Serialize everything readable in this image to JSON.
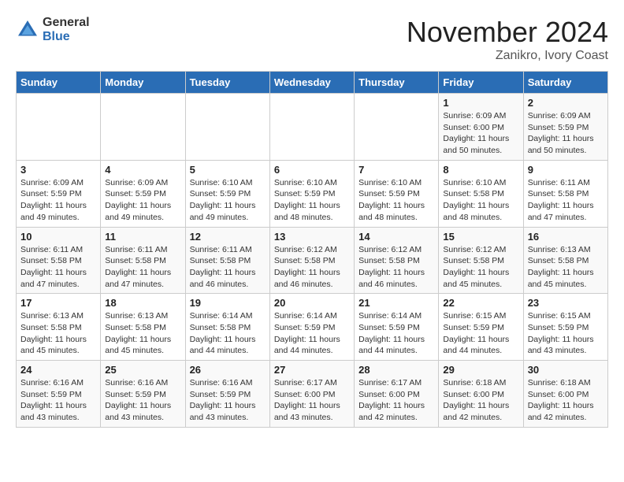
{
  "header": {
    "logo_general": "General",
    "logo_blue": "Blue",
    "month": "November 2024",
    "location": "Zanikro, Ivory Coast"
  },
  "weekdays": [
    "Sunday",
    "Monday",
    "Tuesday",
    "Wednesday",
    "Thursday",
    "Friday",
    "Saturday"
  ],
  "weeks": [
    [
      {
        "day": "",
        "info": ""
      },
      {
        "day": "",
        "info": ""
      },
      {
        "day": "",
        "info": ""
      },
      {
        "day": "",
        "info": ""
      },
      {
        "day": "",
        "info": ""
      },
      {
        "day": "1",
        "info": "Sunrise: 6:09 AM\nSunset: 6:00 PM\nDaylight: 11 hours\nand 50 minutes."
      },
      {
        "day": "2",
        "info": "Sunrise: 6:09 AM\nSunset: 5:59 PM\nDaylight: 11 hours\nand 50 minutes."
      }
    ],
    [
      {
        "day": "3",
        "info": "Sunrise: 6:09 AM\nSunset: 5:59 PM\nDaylight: 11 hours\nand 49 minutes."
      },
      {
        "day": "4",
        "info": "Sunrise: 6:09 AM\nSunset: 5:59 PM\nDaylight: 11 hours\nand 49 minutes."
      },
      {
        "day": "5",
        "info": "Sunrise: 6:10 AM\nSunset: 5:59 PM\nDaylight: 11 hours\nand 49 minutes."
      },
      {
        "day": "6",
        "info": "Sunrise: 6:10 AM\nSunset: 5:59 PM\nDaylight: 11 hours\nand 48 minutes."
      },
      {
        "day": "7",
        "info": "Sunrise: 6:10 AM\nSunset: 5:59 PM\nDaylight: 11 hours\nand 48 minutes."
      },
      {
        "day": "8",
        "info": "Sunrise: 6:10 AM\nSunset: 5:58 PM\nDaylight: 11 hours\nand 48 minutes."
      },
      {
        "day": "9",
        "info": "Sunrise: 6:11 AM\nSunset: 5:58 PM\nDaylight: 11 hours\nand 47 minutes."
      }
    ],
    [
      {
        "day": "10",
        "info": "Sunrise: 6:11 AM\nSunset: 5:58 PM\nDaylight: 11 hours\nand 47 minutes."
      },
      {
        "day": "11",
        "info": "Sunrise: 6:11 AM\nSunset: 5:58 PM\nDaylight: 11 hours\nand 47 minutes."
      },
      {
        "day": "12",
        "info": "Sunrise: 6:11 AM\nSunset: 5:58 PM\nDaylight: 11 hours\nand 46 minutes."
      },
      {
        "day": "13",
        "info": "Sunrise: 6:12 AM\nSunset: 5:58 PM\nDaylight: 11 hours\nand 46 minutes."
      },
      {
        "day": "14",
        "info": "Sunrise: 6:12 AM\nSunset: 5:58 PM\nDaylight: 11 hours\nand 46 minutes."
      },
      {
        "day": "15",
        "info": "Sunrise: 6:12 AM\nSunset: 5:58 PM\nDaylight: 11 hours\nand 45 minutes."
      },
      {
        "day": "16",
        "info": "Sunrise: 6:13 AM\nSunset: 5:58 PM\nDaylight: 11 hours\nand 45 minutes."
      }
    ],
    [
      {
        "day": "17",
        "info": "Sunrise: 6:13 AM\nSunset: 5:58 PM\nDaylight: 11 hours\nand 45 minutes."
      },
      {
        "day": "18",
        "info": "Sunrise: 6:13 AM\nSunset: 5:58 PM\nDaylight: 11 hours\nand 45 minutes."
      },
      {
        "day": "19",
        "info": "Sunrise: 6:14 AM\nSunset: 5:58 PM\nDaylight: 11 hours\nand 44 minutes."
      },
      {
        "day": "20",
        "info": "Sunrise: 6:14 AM\nSunset: 5:59 PM\nDaylight: 11 hours\nand 44 minutes."
      },
      {
        "day": "21",
        "info": "Sunrise: 6:14 AM\nSunset: 5:59 PM\nDaylight: 11 hours\nand 44 minutes."
      },
      {
        "day": "22",
        "info": "Sunrise: 6:15 AM\nSunset: 5:59 PM\nDaylight: 11 hours\nand 44 minutes."
      },
      {
        "day": "23",
        "info": "Sunrise: 6:15 AM\nSunset: 5:59 PM\nDaylight: 11 hours\nand 43 minutes."
      }
    ],
    [
      {
        "day": "24",
        "info": "Sunrise: 6:16 AM\nSunset: 5:59 PM\nDaylight: 11 hours\nand 43 minutes."
      },
      {
        "day": "25",
        "info": "Sunrise: 6:16 AM\nSunset: 5:59 PM\nDaylight: 11 hours\nand 43 minutes."
      },
      {
        "day": "26",
        "info": "Sunrise: 6:16 AM\nSunset: 5:59 PM\nDaylight: 11 hours\nand 43 minutes."
      },
      {
        "day": "27",
        "info": "Sunrise: 6:17 AM\nSunset: 6:00 PM\nDaylight: 11 hours\nand 43 minutes."
      },
      {
        "day": "28",
        "info": "Sunrise: 6:17 AM\nSunset: 6:00 PM\nDaylight: 11 hours\nand 42 minutes."
      },
      {
        "day": "29",
        "info": "Sunrise: 6:18 AM\nSunset: 6:00 PM\nDaylight: 11 hours\nand 42 minutes."
      },
      {
        "day": "30",
        "info": "Sunrise: 6:18 AM\nSunset: 6:00 PM\nDaylight: 11 hours\nand 42 minutes."
      }
    ]
  ]
}
